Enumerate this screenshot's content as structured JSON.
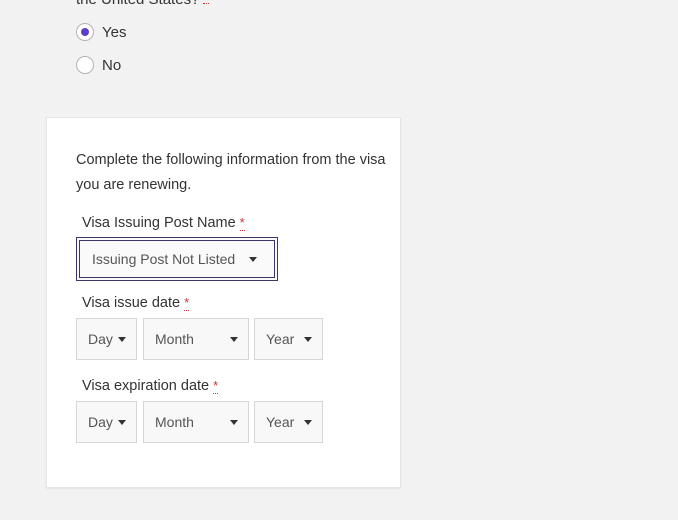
{
  "question": {
    "tail_text": "the United States?"
  },
  "radios": [
    {
      "label": "Yes",
      "checked": true
    },
    {
      "label": "No",
      "checked": false
    }
  ],
  "card": {
    "intro": "Complete the following information from the visa you are renewing.",
    "issuing_post": {
      "label": "Visa Issuing Post Name",
      "required_mark": "*",
      "value": "Issuing Post Not Listed"
    },
    "issue_date": {
      "label": "Visa issue date",
      "required_mark": "*",
      "day": "Day",
      "month": "Month",
      "year": "Year"
    },
    "expiration_date": {
      "label": "Visa expiration date",
      "required_mark": "*",
      "day": "Day",
      "month": "Month",
      "year": "Year"
    }
  },
  "colors": {
    "radio_checked": "#5b3fc4",
    "required": "#cc3333",
    "focus_border": "#3d3468"
  }
}
